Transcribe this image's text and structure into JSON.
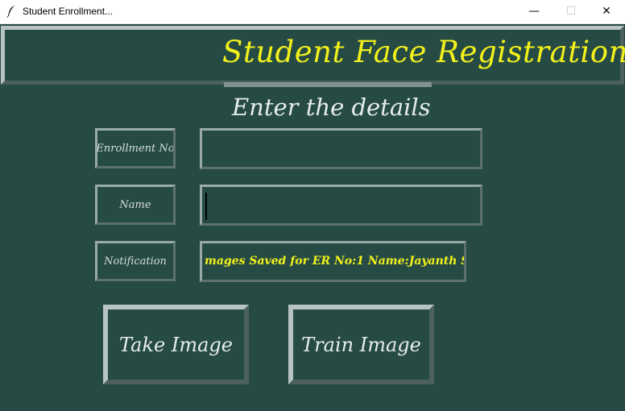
{
  "window": {
    "title": "Student Enrollment...",
    "minimize_glyph": "—",
    "maximize_glyph": "☐",
    "close_glyph": "✕"
  },
  "header": {
    "title": "Student Face Registration"
  },
  "form": {
    "subtitle": "Enter the details",
    "enrollment_label": "Enrollment No",
    "enrollment_value": "",
    "name_label": "Name",
    "name_value": "",
    "notification_label": "Notification",
    "notification_text": "mages Saved for ER No:1 Name:Jayanth S"
  },
  "buttons": {
    "take_image": "Take Image",
    "train_image": "Train Image"
  },
  "colors": {
    "background": "#264b45",
    "accent_yellow": "#f3f11a",
    "border": "#7f948f"
  },
  "icons": [
    "feather-icon"
  ]
}
